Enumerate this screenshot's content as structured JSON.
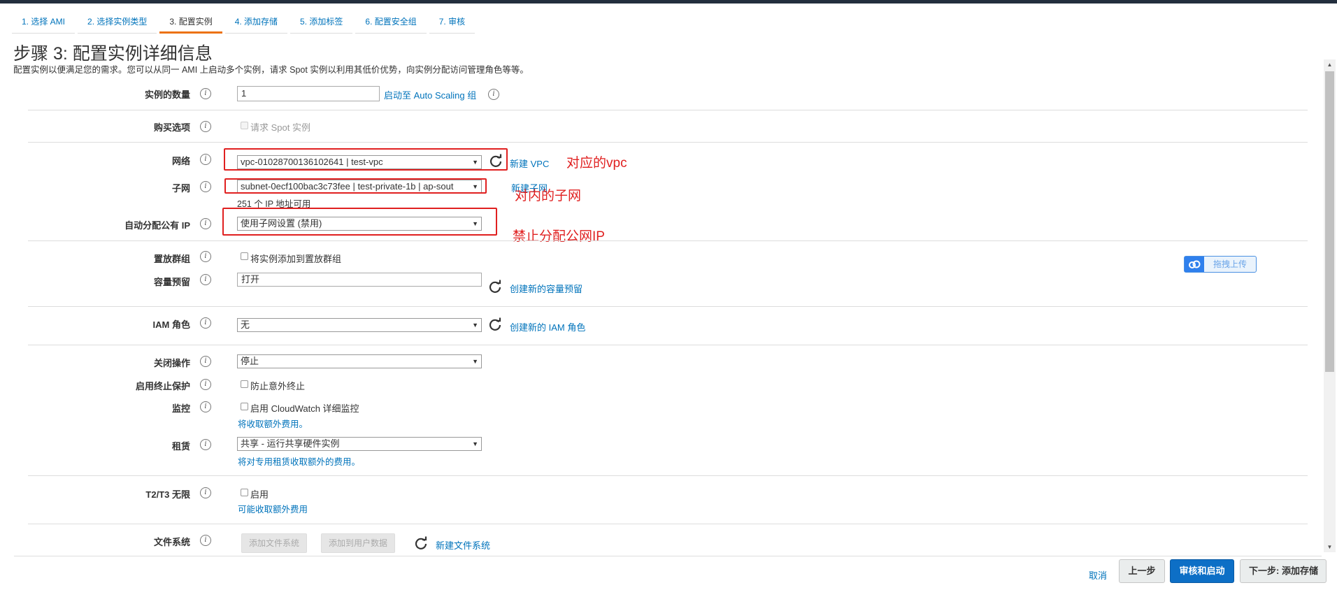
{
  "wizard": {
    "tabs": [
      {
        "label": "1. 选择 AMI"
      },
      {
        "label": "2. 选择实例类型"
      },
      {
        "label": "3. 配置实例"
      },
      {
        "label": "4. 添加存储"
      },
      {
        "label": "5. 添加标签"
      },
      {
        "label": "6. 配置安全组"
      },
      {
        "label": "7. 审核"
      }
    ],
    "active_tab": "3. 配置实例"
  },
  "page": {
    "title": "步骤 3: 配置实例详细信息",
    "description": "配置实例以便满足您的需求。您可以从同一 AMI 上启动多个实例，请求 Spot 实例以利用其低价优势，向实例分配访问管理角色等等。"
  },
  "form": {
    "instance_count": {
      "label": "实例的数量",
      "value": "1",
      "link": "启动至 Auto Scaling 组"
    },
    "purchase": {
      "label": "购买选项",
      "checkbox_label": "请求 Spot 实例"
    },
    "network": {
      "label": "网络",
      "value": "vpc-01028700136102641 | test-vpc",
      "link": "新建 VPC"
    },
    "subnet": {
      "label": "子网",
      "value": "subnet-0ecf100bac3c73fee | test-private-1b | ap-sout",
      "link": "新建子网",
      "note": "251 个 IP 地址可用"
    },
    "public_ip": {
      "label": "自动分配公有 IP",
      "value": "使用子网设置 (禁用)"
    },
    "placement": {
      "label": "置放群组",
      "checkbox_label": "将实例添加到置放群组"
    },
    "capacity": {
      "label": "容量预留",
      "value": "打开",
      "link": "创建新的容量预留"
    },
    "iam": {
      "label": "IAM 角色",
      "value": "无",
      "link": "创建新的 IAM 角色"
    },
    "shutdown": {
      "label": "关闭操作",
      "value": "停止"
    },
    "termination": {
      "label": "启用终止保护",
      "checkbox_label": "防止意外终止"
    },
    "monitoring": {
      "label": "监控",
      "checkbox_label": "启用 CloudWatch 详细监控",
      "note": "将收取额外费用。"
    },
    "tenancy": {
      "label": "租赁",
      "value": "共享 - 运行共享硬件实例",
      "note": "将对专用租赁收取额外的费用。"
    },
    "t2t3": {
      "label": "T2/T3 无限",
      "checkbox_label": "启用",
      "note": "可能收取额外费用"
    },
    "filesystem": {
      "label": "文件系统",
      "btn_add_fs": "添加文件系统",
      "btn_add_userdata": "添加到用户数据",
      "link": "新建文件系统"
    }
  },
  "annotations": {
    "vpc": "对应的vpc",
    "subnet": "对内的子网",
    "public_ip": "禁止分配公网IP",
    "color": "#e02020"
  },
  "upload_widget": {
    "label": "拖拽上传"
  },
  "footer": {
    "cancel": "取消",
    "previous": "上一步",
    "review_launch": "审核和启动",
    "next": "下一步: 添加存储"
  },
  "icons": {
    "info": "info-icon",
    "refresh": "refresh-icon",
    "dropdown": "chevron-down-icon"
  },
  "colors": {
    "link": "#0073bb",
    "primary_button": "#0d6fc6",
    "active_tab_underline": "#ec7211",
    "annotation": "#e02020"
  }
}
